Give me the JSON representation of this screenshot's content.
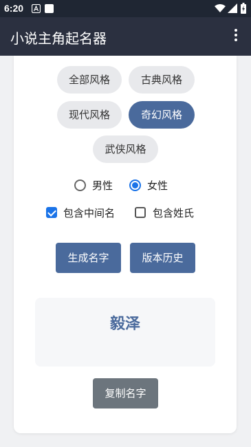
{
  "status_bar": {
    "time": "6:20"
  },
  "app_bar": {
    "title": "小说主角起名器"
  },
  "styles": [
    {
      "label": "全部风格",
      "selected": false
    },
    {
      "label": "古典风格",
      "selected": false
    },
    {
      "label": "现代风格",
      "selected": false
    },
    {
      "label": "奇幻风格",
      "selected": true
    },
    {
      "label": "武侠风格",
      "selected": false
    }
  ],
  "gender": {
    "options": [
      {
        "label": "男性",
        "checked": false
      },
      {
        "label": "女性",
        "checked": true
      }
    ]
  },
  "options": {
    "middle_name": {
      "label": "包含中间名",
      "checked": true
    },
    "surname": {
      "label": "包含姓氏",
      "checked": false
    }
  },
  "actions": {
    "generate_label": "生成名字",
    "history_label": "版本历史",
    "copy_label": "复制名字"
  },
  "result": {
    "name": "毅泽"
  },
  "colors": {
    "accent": "#4a6a9c",
    "app_bar": "#2b3040",
    "status_bar": "#1f2633",
    "control_blue": "#1a73e8",
    "copy_button": "#6c757d"
  }
}
